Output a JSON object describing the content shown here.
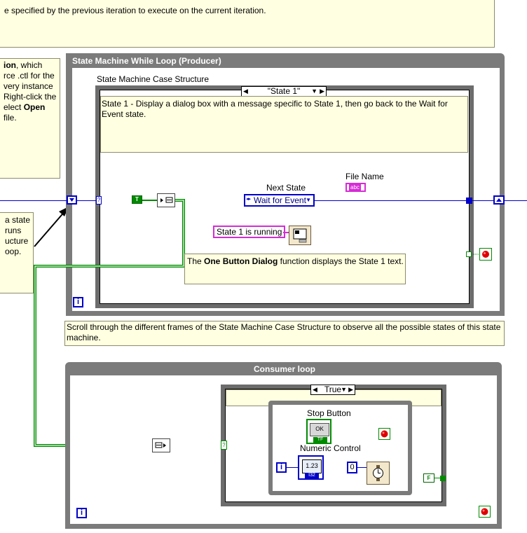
{
  "top_note": {
    "text": "e specified by the previous iteration to execute on the current iteration."
  },
  "left_note_top": {
    "line1_bold": "ion",
    "line1_rest": ", which",
    "line2": "rce .ctl for the",
    "line3": "very instance",
    "line4": "Right-click the",
    "line5_pre": "elect ",
    "line5_bold": "Open",
    "line6": " file."
  },
  "left_note_bottom": {
    "lines": [
      "a state",
      "runs",
      "ucture",
      "oop."
    ]
  },
  "producer_loop": {
    "title": "State Machine While Loop (Producer)"
  },
  "case_structure": {
    "label": "State Machine Case Structure",
    "selector": "\"State 1\""
  },
  "state_note": {
    "text": "State 1 - Display a dialog box with a message specific to State 1, then go back to the Wait for Event state."
  },
  "file_name": {
    "label": "File Name",
    "icon_text": "abc"
  },
  "next_state": {
    "label": "Next State",
    "value": "Wait for Event"
  },
  "bool_true": {
    "text": "T"
  },
  "bool_false": {
    "text": "F"
  },
  "string_constant": {
    "text": "State 1 is running"
  },
  "dialog_note": {
    "pre": "The ",
    "bold": "One Button Dialog",
    "post": " function displays the State 1 text."
  },
  "iteration_icon": {
    "text": "i"
  },
  "scroll_note": {
    "text": "Scroll through the different frames of the State Machine Case Structure to observe all the possible states of this state machine."
  },
  "consumer_loop": {
    "title": "Consumer loop"
  },
  "consumer_case": {
    "selector": "True"
  },
  "stop_button": {
    "label": "Stop Button",
    "ok_text": "OK",
    "tf_text": "TF"
  },
  "numeric_control": {
    "label": "Numeric Control",
    "display": "1.23",
    "type_text": "I32"
  },
  "numeric_const": {
    "value": "0"
  },
  "colors": {
    "wire_blue": "#0000c8",
    "wire_green": "#008a00",
    "wire_pink": "#d62cd6",
    "loop_gray": "#7b7b7b",
    "note_yellow": "#ffffe1",
    "stop_red": "#e00000"
  }
}
